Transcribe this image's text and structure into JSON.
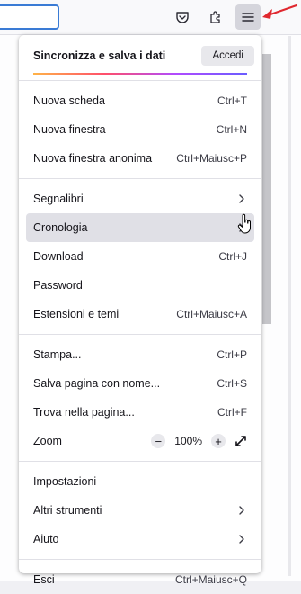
{
  "colors": {
    "accent": "#3a7bd5",
    "annotation_arrow": "#e0282f"
  },
  "toolbar": {
    "pocket_icon": "pocket-icon",
    "extensions_icon": "puzzle-icon",
    "menu_icon": "hamburger-menu-icon"
  },
  "menu": {
    "header": {
      "title": "Sincronizza e salva i dati",
      "login_label": "Accedi"
    },
    "items": [
      {
        "label": "Nuova scheda",
        "shortcut": "Ctrl+T"
      },
      {
        "label": "Nuova finestra",
        "shortcut": "Ctrl+N"
      },
      {
        "label": "Nuova finestra anonima",
        "shortcut": "Ctrl+Maiusc+P"
      },
      {
        "label": "Segnalibri",
        "shortcut": ""
      },
      {
        "label": "Cronologia",
        "shortcut": ""
      },
      {
        "label": "Download",
        "shortcut": "Ctrl+J"
      },
      {
        "label": "Password",
        "shortcut": ""
      },
      {
        "label": "Estensioni e temi",
        "shortcut": "Ctrl+Maiusc+A"
      },
      {
        "label": "Stampa...",
        "shortcut": "Ctrl+P"
      },
      {
        "label": "Salva pagina con nome...",
        "shortcut": "Ctrl+S"
      },
      {
        "label": "Trova nella pagina...",
        "shortcut": "Ctrl+F"
      },
      {
        "label": "Zoom",
        "shortcut": ""
      },
      {
        "label": "Impostazioni",
        "shortcut": ""
      },
      {
        "label": "Altri strumenti",
        "shortcut": ""
      },
      {
        "label": "Aiuto",
        "shortcut": ""
      },
      {
        "label": "Esci",
        "shortcut": "Ctrl+Maiusc+Q"
      }
    ],
    "zoom": {
      "minus": "−",
      "value": "100%",
      "plus": "+"
    }
  }
}
